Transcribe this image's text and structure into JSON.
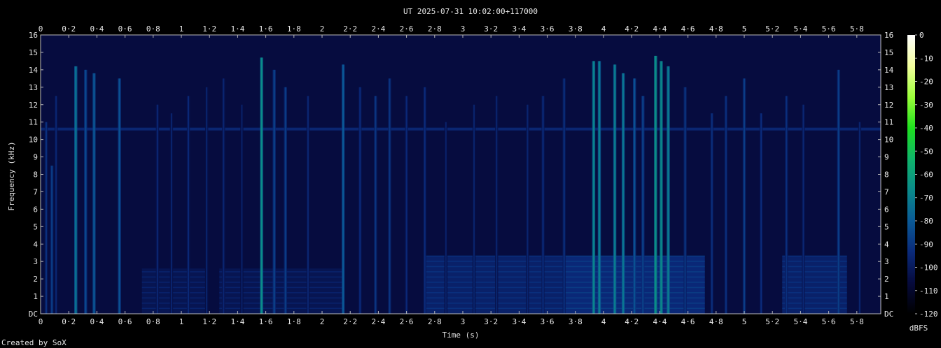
{
  "chart_data": {
    "type": "heatmap",
    "title": "UT 2025-07-31 10:02:00+117000",
    "xlabel": "Time (s)",
    "ylabel": "Frequency (kHz)",
    "colorbar_label": "dBFS",
    "credit": "Created by SoX",
    "xlim": [
      0,
      5.96
    ],
    "ylim": [
      0,
      16
    ],
    "x_ticks": [
      "0",
      "0·2",
      "0·4",
      "0·6",
      "0·8",
      "1",
      "1·2",
      "1·4",
      "1·6",
      "1·8",
      "2",
      "2·2",
      "2·4",
      "2·6",
      "2·8",
      "3",
      "3·2",
      "3·4",
      "3·6",
      "3·8",
      "4",
      "4·2",
      "4·4",
      "4·6",
      "4·8",
      "5",
      "5·2",
      "5·4",
      "5·6",
      "5·8"
    ],
    "y_ticks": [
      "DC",
      "1",
      "2",
      "3",
      "4",
      "5",
      "6",
      "7",
      "8",
      "9",
      "10",
      "11",
      "12",
      "13",
      "14",
      "15",
      "16"
    ],
    "colorbar": {
      "range_dbfs": [
        -120,
        0
      ],
      "ticks": [
        "0",
        "-10",
        "-20",
        "-30",
        "-40",
        "-50",
        "-60",
        "-70",
        "-80",
        "-90",
        "-100",
        "-110",
        "-120"
      ],
      "colors": [
        "#ffffff",
        "#f4ff9e",
        "#9cff3a",
        "#1ee01e",
        "#0fb46a",
        "#0a8a8a",
        "#0a5a96",
        "#0a2a7a",
        "#060a3c",
        "#000000"
      ]
    },
    "tone": {
      "freq_khz": 10.6,
      "level_dbfs": -95
    },
    "transients": [
      {
        "t": 0.04,
        "fmax": 11.0,
        "level": -92
      },
      {
        "t": 0.08,
        "fmax": 8.5,
        "level": -88
      },
      {
        "t": 0.11,
        "fmax": 12.5,
        "level": -95
      },
      {
        "t": 0.25,
        "fmax": 14.2,
        "level": -72
      },
      {
        "t": 0.32,
        "fmax": 14.0,
        "level": -84
      },
      {
        "t": 0.38,
        "fmax": 13.8,
        "level": -80
      },
      {
        "t": 0.56,
        "fmax": 13.5,
        "level": -82
      },
      {
        "t": 0.83,
        "fmax": 12.0,
        "level": -95
      },
      {
        "t": 0.93,
        "fmax": 11.5,
        "level": -96
      },
      {
        "t": 1.05,
        "fmax": 12.5,
        "level": -94
      },
      {
        "t": 1.18,
        "fmax": 13.0,
        "level": -96
      },
      {
        "t": 1.3,
        "fmax": 13.5,
        "level": -95
      },
      {
        "t": 1.43,
        "fmax": 12.0,
        "level": -97
      },
      {
        "t": 1.57,
        "fmax": 14.7,
        "level": -66
      },
      {
        "t": 1.66,
        "fmax": 14.0,
        "level": -86
      },
      {
        "t": 1.74,
        "fmax": 13.0,
        "level": -88
      },
      {
        "t": 1.9,
        "fmax": 12.5,
        "level": -95
      },
      {
        "t": 2.15,
        "fmax": 14.3,
        "level": -80
      },
      {
        "t": 2.27,
        "fmax": 13.0,
        "level": -93
      },
      {
        "t": 2.38,
        "fmax": 12.5,
        "level": -90
      },
      {
        "t": 2.48,
        "fmax": 13.5,
        "level": -90
      },
      {
        "t": 2.6,
        "fmax": 12.5,
        "level": -94
      },
      {
        "t": 2.73,
        "fmax": 13.0,
        "level": -93
      },
      {
        "t": 2.88,
        "fmax": 11.0,
        "level": -97
      },
      {
        "t": 3.08,
        "fmax": 12.0,
        "level": -96
      },
      {
        "t": 3.24,
        "fmax": 12.5,
        "level": -96
      },
      {
        "t": 3.46,
        "fmax": 12.0,
        "level": -96
      },
      {
        "t": 3.57,
        "fmax": 12.5,
        "level": -93
      },
      {
        "t": 3.72,
        "fmax": 13.5,
        "level": -92
      },
      {
        "t": 3.93,
        "fmax": 14.5,
        "level": -68
      },
      {
        "t": 3.97,
        "fmax": 14.5,
        "level": -70
      },
      {
        "t": 4.08,
        "fmax": 14.3,
        "level": -70
      },
      {
        "t": 4.14,
        "fmax": 13.8,
        "level": -72
      },
      {
        "t": 4.22,
        "fmax": 13.5,
        "level": -82
      },
      {
        "t": 4.28,
        "fmax": 12.5,
        "level": -86
      },
      {
        "t": 4.37,
        "fmax": 14.8,
        "level": -64
      },
      {
        "t": 4.41,
        "fmax": 14.5,
        "level": -66
      },
      {
        "t": 4.46,
        "fmax": 14.2,
        "level": -70
      },
      {
        "t": 4.58,
        "fmax": 13.0,
        "level": -90
      },
      {
        "t": 4.77,
        "fmax": 11.5,
        "level": -92
      },
      {
        "t": 4.87,
        "fmax": 12.5,
        "level": -92
      },
      {
        "t": 5.0,
        "fmax": 13.5,
        "level": -88
      },
      {
        "t": 5.12,
        "fmax": 11.5,
        "level": -93
      },
      {
        "t": 5.3,
        "fmax": 12.5,
        "level": -92
      },
      {
        "t": 5.42,
        "fmax": 12.0,
        "level": -95
      },
      {
        "t": 5.67,
        "fmax": 14.0,
        "level": -88
      },
      {
        "t": 5.82,
        "fmax": 11.0,
        "level": -96
      }
    ],
    "harmonic_segments": [
      {
        "t0": 0.72,
        "t1": 1.17,
        "fmax": 2.6,
        "level": -98
      },
      {
        "t0": 1.27,
        "t1": 2.15,
        "fmax": 2.6,
        "level": -98
      },
      {
        "t0": 2.73,
        "t1": 3.72,
        "fmax": 3.3,
        "level": -93
      },
      {
        "t0": 3.72,
        "t1": 4.72,
        "fmax": 3.3,
        "level": -90
      },
      {
        "t0": 5.27,
        "t1": 5.73,
        "fmax": 3.3,
        "level": -93
      }
    ]
  }
}
